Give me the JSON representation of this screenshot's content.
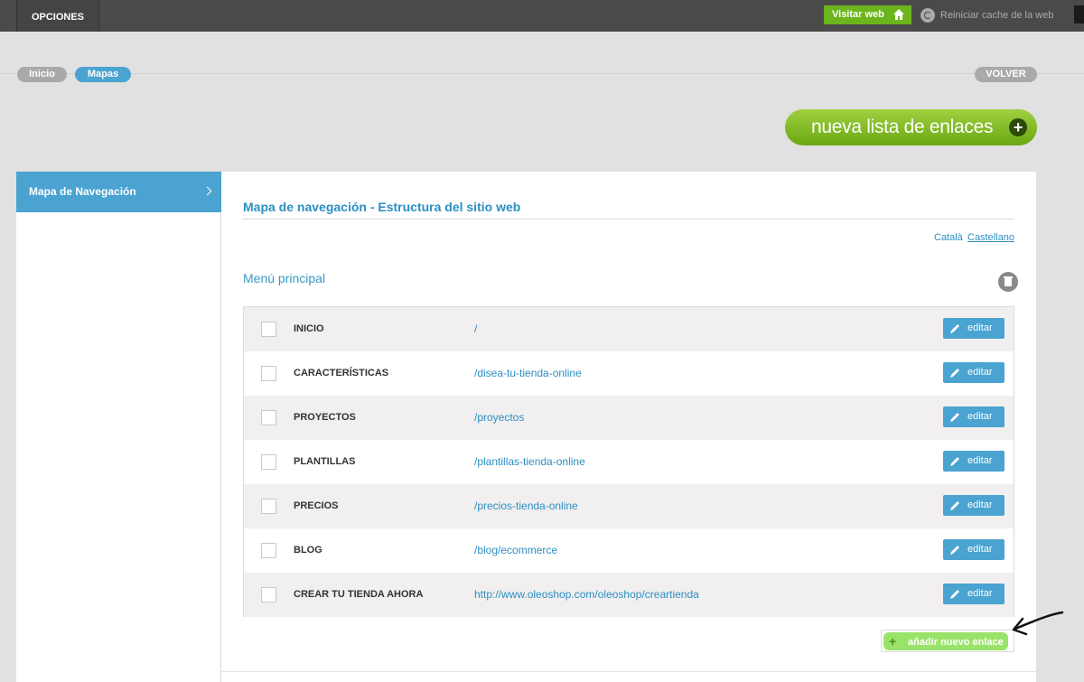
{
  "topbar": {
    "opciones": "OPCIONES",
    "visitar": "Visitar web",
    "reiniciar": "Reiniciar cache de la web"
  },
  "breadcrumb": {
    "inicio": "Inicio",
    "mapas": "Mapas",
    "volver": "VOLVER"
  },
  "nueva_lista": "nueva lista de enlaces",
  "sidebar": {
    "active": "Mapa de Navegación"
  },
  "panel": {
    "title": "Mapa de navegación - Estructura del sitio web",
    "langs": [
      "Català",
      "Castellano"
    ],
    "menu_title": "Menú principal",
    "edit_label": "editar",
    "rows": [
      {
        "name": "INICIO",
        "url": "/"
      },
      {
        "name": "CARACTERÍSTICAS",
        "url": "/disea-tu-tienda-online"
      },
      {
        "name": "PROYECTOS",
        "url": "/proyectos"
      },
      {
        "name": "PLANTILLAS",
        "url": "/plantillas-tienda-online"
      },
      {
        "name": "PRECIOS",
        "url": "/precios-tienda-online"
      },
      {
        "name": "BLOG",
        "url": "/blog/ecommerce"
      },
      {
        "name": "CREAR TU TIENDA AHORA",
        "url": "http://www.oleoshop.com/oleoshop/creartienda"
      }
    ],
    "add_label": "añadir nuevo enlace"
  },
  "colors": {
    "accent_blue": "#4aa3d0",
    "green": "#6cb51c"
  }
}
